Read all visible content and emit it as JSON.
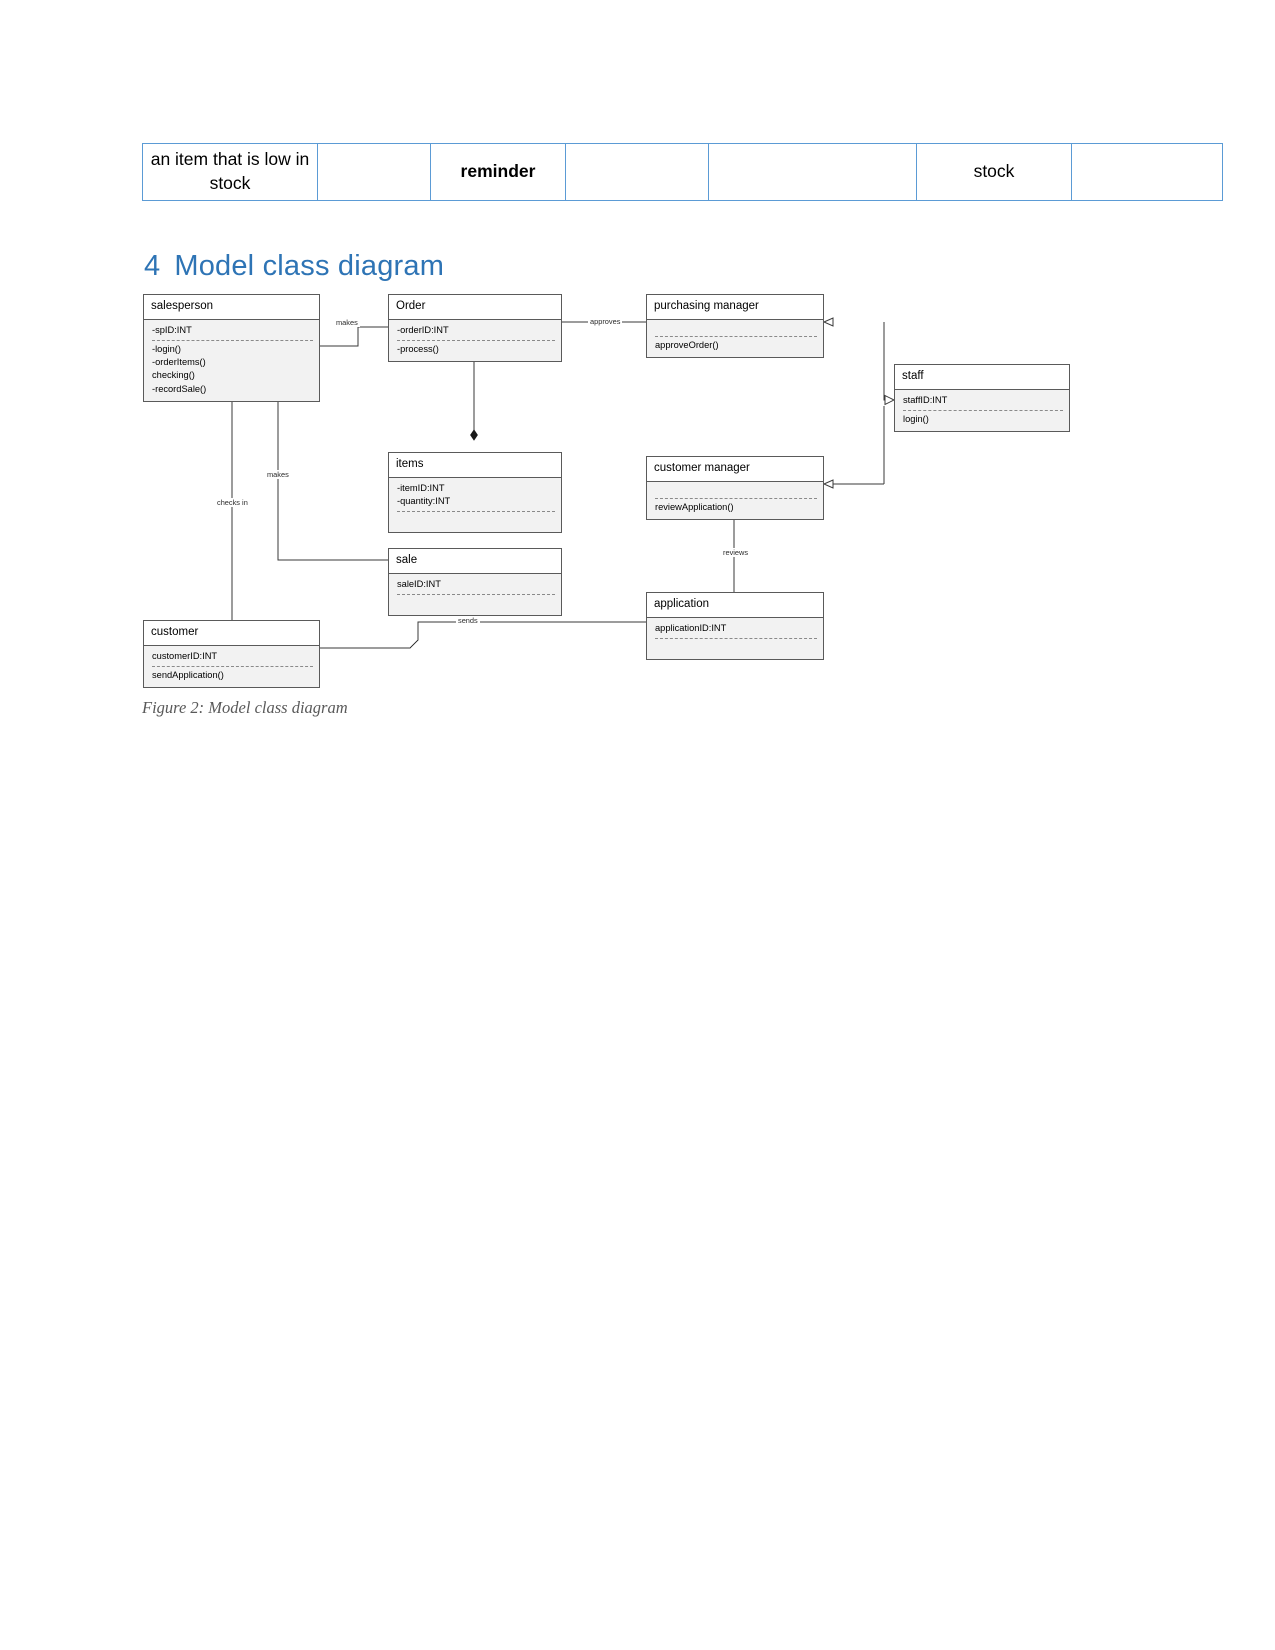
{
  "document": {
    "table": {
      "rows": [
        {
          "cells": [
            {
              "text": "an item that is low in stock",
              "bold": false
            },
            {
              "text": "",
              "bold": false
            },
            {
              "text": "reminder",
              "bold": true
            },
            {
              "text": "",
              "bold": false
            },
            {
              "text": "",
              "bold": false
            },
            {
              "text": "stock",
              "bold": false
            },
            {
              "text": "",
              "bold": false
            }
          ]
        }
      ]
    },
    "heading": {
      "number": "4",
      "text": "Model class diagram",
      "color": "#2e74b5"
    },
    "caption": "Figure 2: Model class diagram"
  },
  "diagram": {
    "type": "uml-class-diagram",
    "classes": [
      {
        "id": "salesperson",
        "name": "salesperson",
        "attributes": [
          "-spID:INT"
        ],
        "methods": [
          "-login()",
          "-orderItems()",
          "checking()",
          "-recordSale()"
        ]
      },
      {
        "id": "order",
        "name": "Order",
        "attributes": [
          "-orderID:INT"
        ],
        "methods": [
          "-process()"
        ]
      },
      {
        "id": "purchasing-manager",
        "name": "purchasing manager",
        "attributes": [],
        "methods": [
          "approveOrder()"
        ]
      },
      {
        "id": "staff",
        "name": "staff",
        "attributes": [
          "staffID:INT"
        ],
        "methods": [
          "login()"
        ]
      },
      {
        "id": "items",
        "name": "items",
        "attributes": [
          "-itemID:INT",
          "-quantity:INT"
        ],
        "methods": []
      },
      {
        "id": "customer-manager",
        "name": "customer manager",
        "attributes": [],
        "methods": [
          "reviewApplication()"
        ]
      },
      {
        "id": "sale",
        "name": "sale",
        "attributes": [
          "saleID:INT"
        ],
        "methods": []
      },
      {
        "id": "application",
        "name": "application",
        "attributes": [
          "applicationID:INT"
        ],
        "methods": []
      },
      {
        "id": "customer",
        "name": "customer",
        "attributes": [
          "customerID:INT"
        ],
        "methods": [
          "sendApplication()"
        ]
      }
    ],
    "relationships": [
      {
        "from": "salesperson",
        "to": "order",
        "label": "makes",
        "kind": "association"
      },
      {
        "from": "order",
        "to": "purchasing-manager",
        "label": "approves",
        "kind": "association"
      },
      {
        "from": "order",
        "to": "items",
        "label": "",
        "kind": "composition"
      },
      {
        "from": "salesperson",
        "to": "sale",
        "label": "makes",
        "kind": "association"
      },
      {
        "from": "salesperson",
        "to": "customer",
        "label": "checks in",
        "kind": "association"
      },
      {
        "from": "purchasing-manager",
        "to": "staff",
        "label": "",
        "kind": "generalization"
      },
      {
        "from": "customer-manager",
        "to": "staff",
        "label": "",
        "kind": "generalization"
      },
      {
        "from": "customer-manager",
        "to": "application",
        "label": "reviews",
        "kind": "association"
      },
      {
        "from": "customer",
        "to": "application",
        "label": "sends",
        "kind": "association"
      }
    ]
  }
}
